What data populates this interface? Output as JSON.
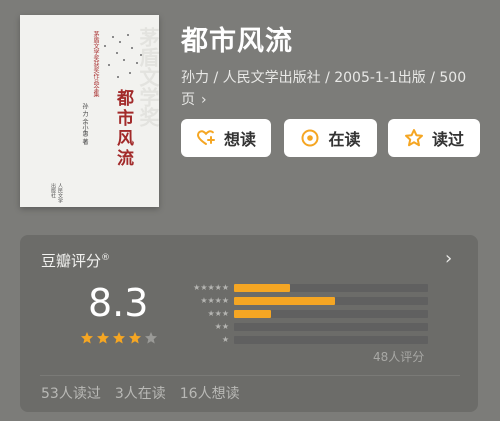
{
  "book": {
    "title": "都市风流",
    "meta": "孙力 / 人民文学出版社 / 2005-1-1出版 / 500页",
    "cover": {
      "title": "都市风流",
      "series": "茅盾文学奖获奖作品全集",
      "author": "孙 力 余小惠 著",
      "publisher": "人民文学出版社",
      "award": "茅盾文学奖"
    }
  },
  "actions": {
    "want": "想读",
    "reading": "在读",
    "read": "读过"
  },
  "rating": {
    "title": "豆瓣评分",
    "registered": "®",
    "score": "8.3",
    "stars": 4,
    "distribution": [
      0.29,
      0.52,
      0.19,
      0,
      0
    ],
    "count": "48人评分"
  },
  "stats": {
    "read": "53人读过",
    "reading": "3人在读",
    "want": "16人想读"
  },
  "colors": {
    "accent": "#f5a623",
    "background": "#7c7c79",
    "card": "#6c6c69"
  }
}
